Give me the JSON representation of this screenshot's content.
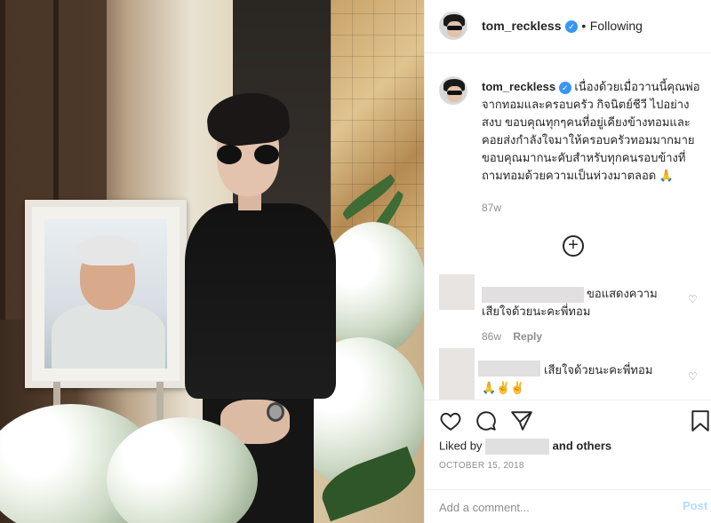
{
  "header": {
    "username": "tom_reckless",
    "separator": "•",
    "follow_status": "Following"
  },
  "caption": {
    "username": "tom_reckless",
    "text": "เนื่องด้วยเมื่อวานนี้คุณพ่อจากทอมและครอบครัว กิจนิตย์ชีวี ไปอย่างสงบ ขอบคุณทุกๆคนที่อยู่เคียงข้างทอมและคอยส่งกำลังใจมาให้ครอบครัวทอมมากมาย ขอบคุณมากนะคับสำหรับทุกคนรอบข้างที่ถามทอมด้วยความเป็นห่วงมาตลอด 🙏",
    "time": "87w"
  },
  "comments": [
    {
      "text": "ขอแสดงความเสียใจด้วยนะคะพี่ทอม",
      "time": "86w",
      "reply_label": "Reply"
    },
    {
      "text": "เสียใจด้วยนะคะพี่ทอม",
      "emojis": "🙏✌️✌️"
    }
  ],
  "likes": {
    "prefix": "Liked by",
    "suffix": "and others"
  },
  "date": "OCTOBER 15, 2018",
  "add_comment": {
    "placeholder": "Add a comment...",
    "post_label": "Post"
  },
  "colors": {
    "verified": "#3897f0",
    "post_disabled": "#b3dbff",
    "meta_gray": "#8e8e8e"
  },
  "icons": [
    "more-comments-icon",
    "heart-icon",
    "comment-icon",
    "share-icon",
    "bookmark-icon",
    "verified-icon"
  ]
}
